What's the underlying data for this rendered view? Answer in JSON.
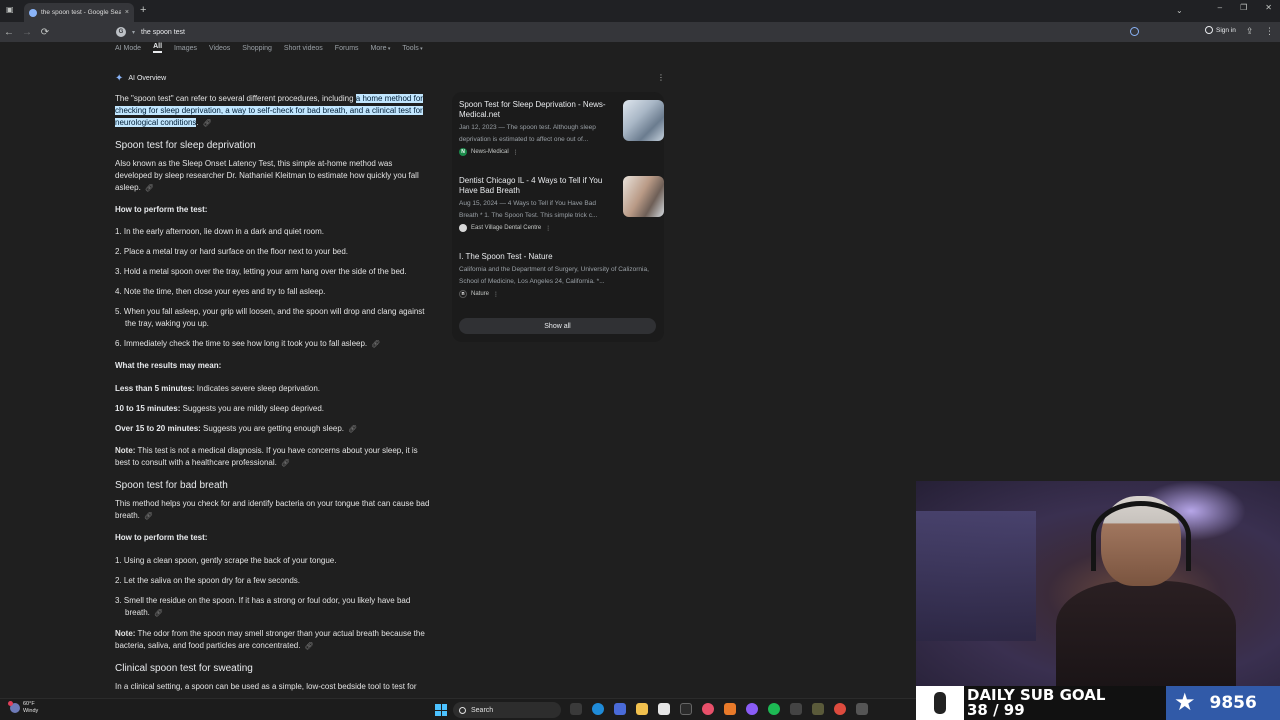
{
  "browser": {
    "tab_title": "the spoon test - Google Search",
    "tab_close": "×",
    "new_tab": "+",
    "address": "the spoon test",
    "sign_in": "Sign in",
    "nav": {
      "back": "←",
      "forward": "→",
      "reload": "⟳"
    },
    "win": {
      "minimize": "–",
      "restore": "❐",
      "close": "✕"
    }
  },
  "search_tabs": [
    {
      "label": "AI Mode"
    },
    {
      "label": "All"
    },
    {
      "label": "Images"
    },
    {
      "label": "Videos"
    },
    {
      "label": "Shopping"
    },
    {
      "label": "Short videos"
    },
    {
      "label": "Forums"
    },
    {
      "label": "More"
    },
    {
      "label": "Tools"
    }
  ],
  "ai": {
    "heading": "AI Overview",
    "intro_plain": "The \"spoon test\" can refer to several different procedures, including ",
    "intro_highlight": "a home method for checking for sleep deprivation, a way to self-check for bad breath, and a clinical test for neurological conditions",
    "intro_end": ".",
    "sleep": {
      "title": "Spoon test for sleep deprivation",
      "desc": "Also known as the Sleep Onset Latency Test, this simple at-home method was developed by sleep researcher Dr. Nathaniel Kleitman to estimate how quickly you fall asleep.",
      "how_head": "How to perform the test:",
      "steps": [
        "1. In the early afternoon, lie down in a dark and quiet room.",
        "2. Place a metal tray or hard surface on the floor next to your bed.",
        "3. Hold a metal spoon over the tray, letting your arm hang over the side of the bed.",
        "4. Note the time, then close your eyes and try to fall asleep.",
        "5. When you fall asleep, your grip will loosen, and the spoon will drop and clang against the tray, waking you up.",
        "6. Immediately check the time to see how long it took you to fall asleep."
      ],
      "results_head": "What the results may mean:",
      "results": [
        {
          "label": "Less than 5 minutes:",
          "text": " Indicates severe sleep deprivation."
        },
        {
          "label": "10 to 15 minutes:",
          "text": " Suggests you are mildly sleep deprived."
        },
        {
          "label": "Over 15 to 20 minutes:",
          "text": " Suggests you are getting enough sleep."
        }
      ],
      "note_label": "Note:",
      "note": " This test is not a medical diagnosis. If you have concerns about your sleep, it is best to consult with a healthcare professional."
    },
    "breath": {
      "title": "Spoon test for bad breath",
      "desc": "This method helps you check for and identify bacteria on your tongue that can cause bad breath.",
      "how_head": "How to perform the test:",
      "steps": [
        "1. Using a clean spoon, gently scrape the back of your tongue.",
        "2. Let the saliva on the spoon dry for a few seconds.",
        "3. Smell the residue on the spoon. If it has a strong or foul odor, you likely have bad breath."
      ],
      "note_label": "Note:",
      "note": " The odor from the spoon may smell stronger than your actual breath because the bacteria, saliva, and food particles are concentrated."
    },
    "clinical": {
      "title": "Clinical spoon test for sweating",
      "desc": "In a clinical setting, a spoon can be used as a simple, low-cost bedside tool to test for"
    }
  },
  "sources": [
    {
      "title": "Spoon Test for Sleep Deprivation - News-Medical.net",
      "snippet": "Jan 12, 2023 — The spoon test. Although sleep deprivation is estimated to affect one out of...",
      "site": "News-Medical",
      "fav": "N",
      "fav_color": "#1a8a4a"
    },
    {
      "title": "Dentist Chicago IL - 4 Ways to Tell if You Have Bad Breath",
      "snippet": "Aug 15, 2024 — 4 Ways to Tell if You Have Bad Breath * 1. The Spoon Test. This simple trick c...",
      "site": "East Village Dental Centre",
      "fav": "",
      "fav_color": "#d8d8d8"
    },
    {
      "title": "I. The Spoon Test - Nature",
      "snippet": "California and the Department of Surgery, University of Calizornia, School of Medicine, Los Angeles 24, California. *...",
      "site": "Nature",
      "fav": "n",
      "fav_color": "#1b1b1b"
    }
  ],
  "show_all": "Show all",
  "overlay": {
    "goal_line1": "DAILY SUB GOAL",
    "goal_line2": "38 / 99",
    "count": "9856"
  },
  "taskbar": {
    "weather_temp": "60°F",
    "weather_desc": "Windy",
    "search": "Search"
  },
  "colors": {
    "page_bg": "#1f1f1f",
    "highlight": "#c2e7ff",
    "goal_blue": "#315aa8"
  }
}
